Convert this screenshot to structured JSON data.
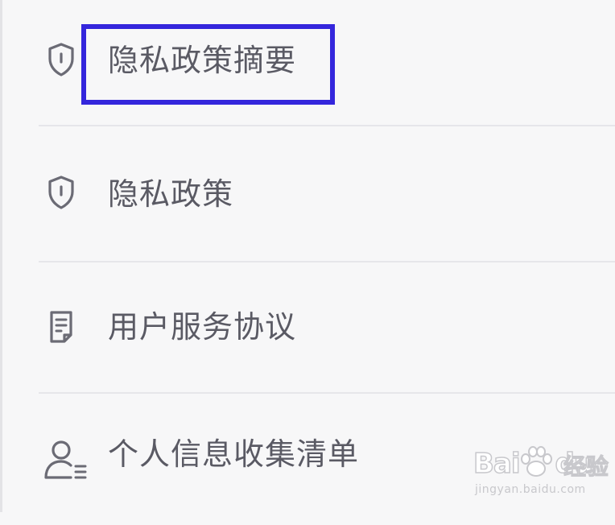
{
  "menu": {
    "items": [
      {
        "label": "隐私政策摘要",
        "icon": "shield-icon",
        "highlighted": true
      },
      {
        "label": "隐私政策",
        "icon": "shield-icon",
        "highlighted": false
      },
      {
        "label": "用户服务协议",
        "icon": "document-icon",
        "highlighted": false
      },
      {
        "label": "个人信息收集清单",
        "icon": "user-info-icon",
        "highlighted": false
      }
    ]
  },
  "highlight_color": "#3426dc",
  "text_color": "#5a5a64",
  "watermark": {
    "brand": "Bai",
    "brand_suffix": "du",
    "name": "经验",
    "url": "jingyan.baidu.com"
  }
}
